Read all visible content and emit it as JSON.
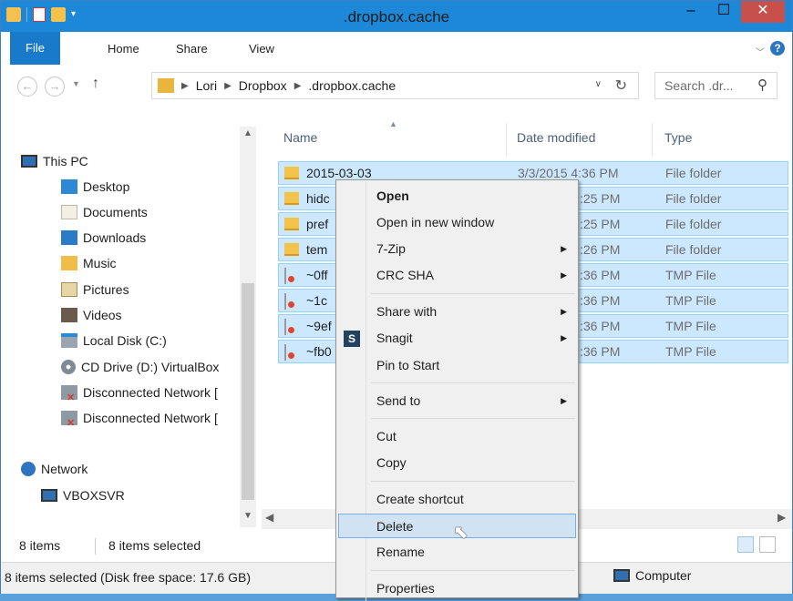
{
  "window": {
    "title": ".dropbox.cache",
    "min_symbol": "–",
    "max_symbol": "☐",
    "close_symbol": "✕"
  },
  "ribbon": {
    "tabs": [
      "File",
      "Home",
      "Share",
      "View"
    ],
    "help_symbol": "?"
  },
  "address": {
    "crumbs": [
      "Lori",
      "Dropbox",
      ".dropbox.cache"
    ],
    "search_placeholder": "Search .dr..."
  },
  "sidebar": {
    "this_pc": "This PC",
    "items": [
      "Desktop",
      "Documents",
      "Downloads",
      "Music",
      "Pictures",
      "Videos",
      "Local Disk (C:)",
      "CD Drive (D:) VirtualBox",
      "Disconnected Network [",
      "Disconnected Network ["
    ],
    "network": "Network",
    "vboxsvr": "VBOXSVR"
  },
  "columns": {
    "name": "Name",
    "date": "Date modified",
    "type": "Type"
  },
  "files": [
    {
      "name": "2015-03-03",
      "date": "3/3/2015 4:36 PM",
      "type": "File folder",
      "kind": "folder"
    },
    {
      "name": "hidc",
      "date": ":25 PM",
      "type": "File folder",
      "kind": "folder"
    },
    {
      "name": "pref",
      "date": ":25 PM",
      "type": "File folder",
      "kind": "folder"
    },
    {
      "name": "tem",
      "date": ":26 PM",
      "type": "File folder",
      "kind": "folder"
    },
    {
      "name": "~0ff",
      "date": ":36 PM",
      "type": "TMP File",
      "kind": "tmp"
    },
    {
      "name": "~1c",
      "date": ":36 PM",
      "type": "TMP File",
      "kind": "tmp"
    },
    {
      "name": "~9ef",
      "date": ":36 PM",
      "type": "TMP File",
      "kind": "tmp"
    },
    {
      "name": "~fb0",
      "date": ":36 PM",
      "type": "TMP File",
      "kind": "tmp"
    }
  ],
  "status": {
    "items_count": "8 items",
    "selected": "8 items selected",
    "detail": "8 items selected (Disk free space: 17.6 GB)",
    "computer": "Computer"
  },
  "context_menu": {
    "open": "Open",
    "open_new_window": "Open in new window",
    "seven_zip": "7-Zip",
    "crc_sha": "CRC SHA",
    "share_with": "Share with",
    "snagit": "Snagit",
    "pin_to_start": "Pin to Start",
    "send_to": "Send to",
    "cut": "Cut",
    "copy": "Copy",
    "create_shortcut": "Create shortcut",
    "delete": "Delete",
    "rename": "Rename",
    "properties": "Properties",
    "snagit_glyph": "S"
  },
  "colors": {
    "accent": "#1d88d8",
    "selection": "#cce8ff",
    "menu_hover": "#d1e2f2"
  }
}
